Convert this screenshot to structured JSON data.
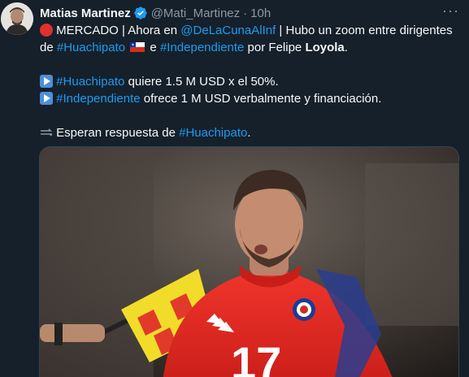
{
  "author": {
    "name": "Matias Martinez",
    "handle": "@Mati_Martinez",
    "separator": "·",
    "time": "10h"
  },
  "more_label": "···",
  "text": {
    "l1_a": " MERCADO | Ahora en ",
    "l1_link": "@DeLaCunaAlInf",
    "l1_b": " | Hubo un zoom entre dirigentes",
    "l2_a": "de ",
    "l2_link1": "#Huachipato",
    "l2_b": " e ",
    "l2_link2": "#Independiente",
    "l2_c": " por Felipe ",
    "l2_bold": "Loyola",
    "l2_d": ".",
    "l3_link": "#Huachipato",
    "l3_b": " quiere 1.5 M USD x el 50%.",
    "l4_link": "#Independiente",
    "l4_b": " ofrece 1 M USD verbalmente y financiación.",
    "l5_a": " Esperan respuesta de ",
    "l5_link": "#Huachipato",
    "l5_b": "."
  },
  "media": {
    "jersey_number": "17"
  },
  "colors": {
    "background": "#15202b",
    "link": "#1d9bf0",
    "muted": "#8b98a5",
    "verified": "#1d9bf0",
    "jersey": "#e8251f"
  }
}
